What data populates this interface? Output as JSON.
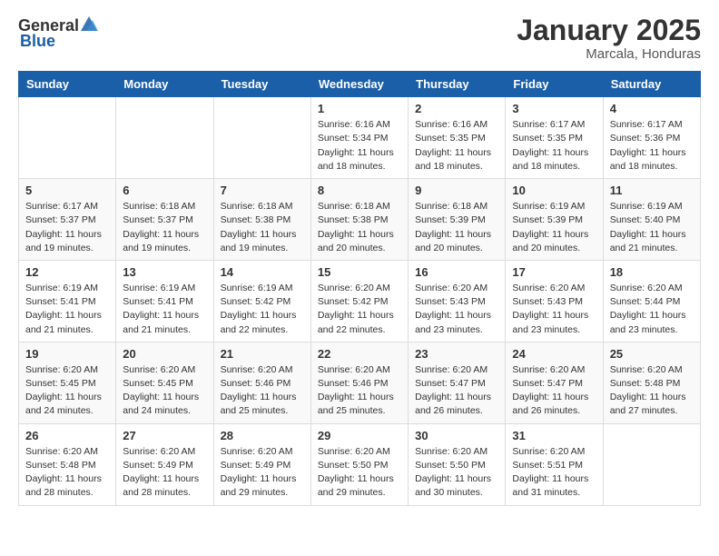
{
  "header": {
    "logo_general": "General",
    "logo_blue": "Blue",
    "main_title": "January 2025",
    "subtitle": "Marcala, Honduras"
  },
  "weekdays": [
    "Sunday",
    "Monday",
    "Tuesday",
    "Wednesday",
    "Thursday",
    "Friday",
    "Saturday"
  ],
  "weeks": [
    [
      {
        "num": "",
        "info": ""
      },
      {
        "num": "",
        "info": ""
      },
      {
        "num": "",
        "info": ""
      },
      {
        "num": "1",
        "info": "Sunrise: 6:16 AM\nSunset: 5:34 PM\nDaylight: 11 hours and 18 minutes."
      },
      {
        "num": "2",
        "info": "Sunrise: 6:16 AM\nSunset: 5:35 PM\nDaylight: 11 hours and 18 minutes."
      },
      {
        "num": "3",
        "info": "Sunrise: 6:17 AM\nSunset: 5:35 PM\nDaylight: 11 hours and 18 minutes."
      },
      {
        "num": "4",
        "info": "Sunrise: 6:17 AM\nSunset: 5:36 PM\nDaylight: 11 hours and 18 minutes."
      }
    ],
    [
      {
        "num": "5",
        "info": "Sunrise: 6:17 AM\nSunset: 5:37 PM\nDaylight: 11 hours and 19 minutes."
      },
      {
        "num": "6",
        "info": "Sunrise: 6:18 AM\nSunset: 5:37 PM\nDaylight: 11 hours and 19 minutes."
      },
      {
        "num": "7",
        "info": "Sunrise: 6:18 AM\nSunset: 5:38 PM\nDaylight: 11 hours and 19 minutes."
      },
      {
        "num": "8",
        "info": "Sunrise: 6:18 AM\nSunset: 5:38 PM\nDaylight: 11 hours and 20 minutes."
      },
      {
        "num": "9",
        "info": "Sunrise: 6:18 AM\nSunset: 5:39 PM\nDaylight: 11 hours and 20 minutes."
      },
      {
        "num": "10",
        "info": "Sunrise: 6:19 AM\nSunset: 5:39 PM\nDaylight: 11 hours and 20 minutes."
      },
      {
        "num": "11",
        "info": "Sunrise: 6:19 AM\nSunset: 5:40 PM\nDaylight: 11 hours and 21 minutes."
      }
    ],
    [
      {
        "num": "12",
        "info": "Sunrise: 6:19 AM\nSunset: 5:41 PM\nDaylight: 11 hours and 21 minutes."
      },
      {
        "num": "13",
        "info": "Sunrise: 6:19 AM\nSunset: 5:41 PM\nDaylight: 11 hours and 21 minutes."
      },
      {
        "num": "14",
        "info": "Sunrise: 6:19 AM\nSunset: 5:42 PM\nDaylight: 11 hours and 22 minutes."
      },
      {
        "num": "15",
        "info": "Sunrise: 6:20 AM\nSunset: 5:42 PM\nDaylight: 11 hours and 22 minutes."
      },
      {
        "num": "16",
        "info": "Sunrise: 6:20 AM\nSunset: 5:43 PM\nDaylight: 11 hours and 23 minutes."
      },
      {
        "num": "17",
        "info": "Sunrise: 6:20 AM\nSunset: 5:43 PM\nDaylight: 11 hours and 23 minutes."
      },
      {
        "num": "18",
        "info": "Sunrise: 6:20 AM\nSunset: 5:44 PM\nDaylight: 11 hours and 23 minutes."
      }
    ],
    [
      {
        "num": "19",
        "info": "Sunrise: 6:20 AM\nSunset: 5:45 PM\nDaylight: 11 hours and 24 minutes."
      },
      {
        "num": "20",
        "info": "Sunrise: 6:20 AM\nSunset: 5:45 PM\nDaylight: 11 hours and 24 minutes."
      },
      {
        "num": "21",
        "info": "Sunrise: 6:20 AM\nSunset: 5:46 PM\nDaylight: 11 hours and 25 minutes."
      },
      {
        "num": "22",
        "info": "Sunrise: 6:20 AM\nSunset: 5:46 PM\nDaylight: 11 hours and 25 minutes."
      },
      {
        "num": "23",
        "info": "Sunrise: 6:20 AM\nSunset: 5:47 PM\nDaylight: 11 hours and 26 minutes."
      },
      {
        "num": "24",
        "info": "Sunrise: 6:20 AM\nSunset: 5:47 PM\nDaylight: 11 hours and 26 minutes."
      },
      {
        "num": "25",
        "info": "Sunrise: 6:20 AM\nSunset: 5:48 PM\nDaylight: 11 hours and 27 minutes."
      }
    ],
    [
      {
        "num": "26",
        "info": "Sunrise: 6:20 AM\nSunset: 5:48 PM\nDaylight: 11 hours and 28 minutes."
      },
      {
        "num": "27",
        "info": "Sunrise: 6:20 AM\nSunset: 5:49 PM\nDaylight: 11 hours and 28 minutes."
      },
      {
        "num": "28",
        "info": "Sunrise: 6:20 AM\nSunset: 5:49 PM\nDaylight: 11 hours and 29 minutes."
      },
      {
        "num": "29",
        "info": "Sunrise: 6:20 AM\nSunset: 5:50 PM\nDaylight: 11 hours and 29 minutes."
      },
      {
        "num": "30",
        "info": "Sunrise: 6:20 AM\nSunset: 5:50 PM\nDaylight: 11 hours and 30 minutes."
      },
      {
        "num": "31",
        "info": "Sunrise: 6:20 AM\nSunset: 5:51 PM\nDaylight: 11 hours and 31 minutes."
      },
      {
        "num": "",
        "info": ""
      }
    ]
  ]
}
